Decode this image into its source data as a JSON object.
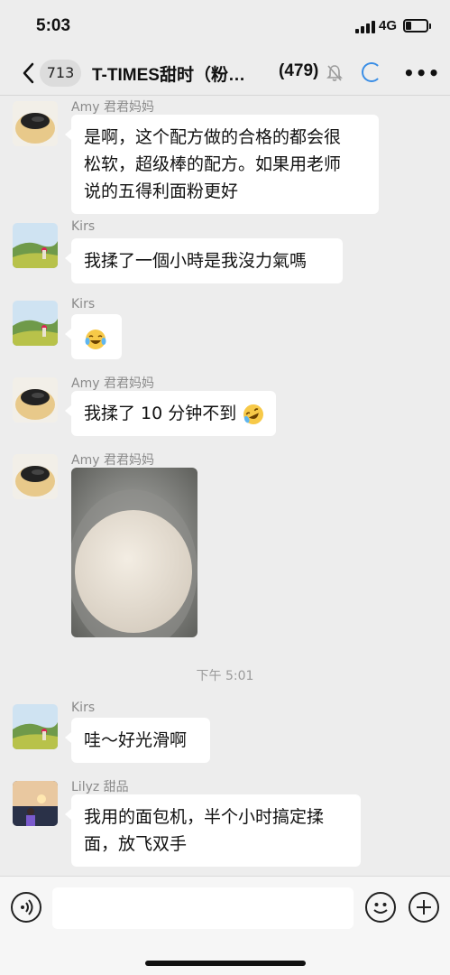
{
  "status_bar": {
    "time": "5:03",
    "network": "4G",
    "battery_level": 0.25
  },
  "nav": {
    "unread_count": "713",
    "title": "T-TIMES甜时（粉…",
    "member_count": "(479)"
  },
  "messages": [
    {
      "sender": "Amy 君君妈妈",
      "lines": [
        "是啊，这个配方做的合格的都会很",
        "松软，超级棒的配方。如果用老师",
        "说的五得利面粉更好"
      ],
      "avatar": "amy"
    },
    {
      "sender": "Kirs",
      "lines": [
        "我揉了一個小時是我沒力氣嗎"
      ],
      "avatar": "kirs"
    },
    {
      "sender": "Kirs",
      "emoji": "laughing-tears",
      "avatar": "kirs"
    },
    {
      "sender": "Amy 君君妈妈",
      "lines": [
        "我揉了 10 分钟不到"
      ],
      "emoji": "rolling-laughing",
      "avatar": "amy"
    },
    {
      "sender": "Amy 君君妈妈",
      "image": "dough-ball-photo",
      "avatar": "amy"
    },
    {
      "sender": "Kirs",
      "lines": [
        "哇～好光滑啊"
      ],
      "avatar": "kirs"
    },
    {
      "sender": "Lilyz 甜品",
      "lines": [
        "我用的面包机，半个小时搞定揉",
        "面，放飞双手"
      ],
      "avatar": "lilyz"
    }
  ],
  "time_divider": "下午 5:01",
  "input": {
    "placeholder": ""
  },
  "colors": {
    "background": "#ededed",
    "bubble": "#ffffff",
    "accent": "#3a8ee6"
  }
}
